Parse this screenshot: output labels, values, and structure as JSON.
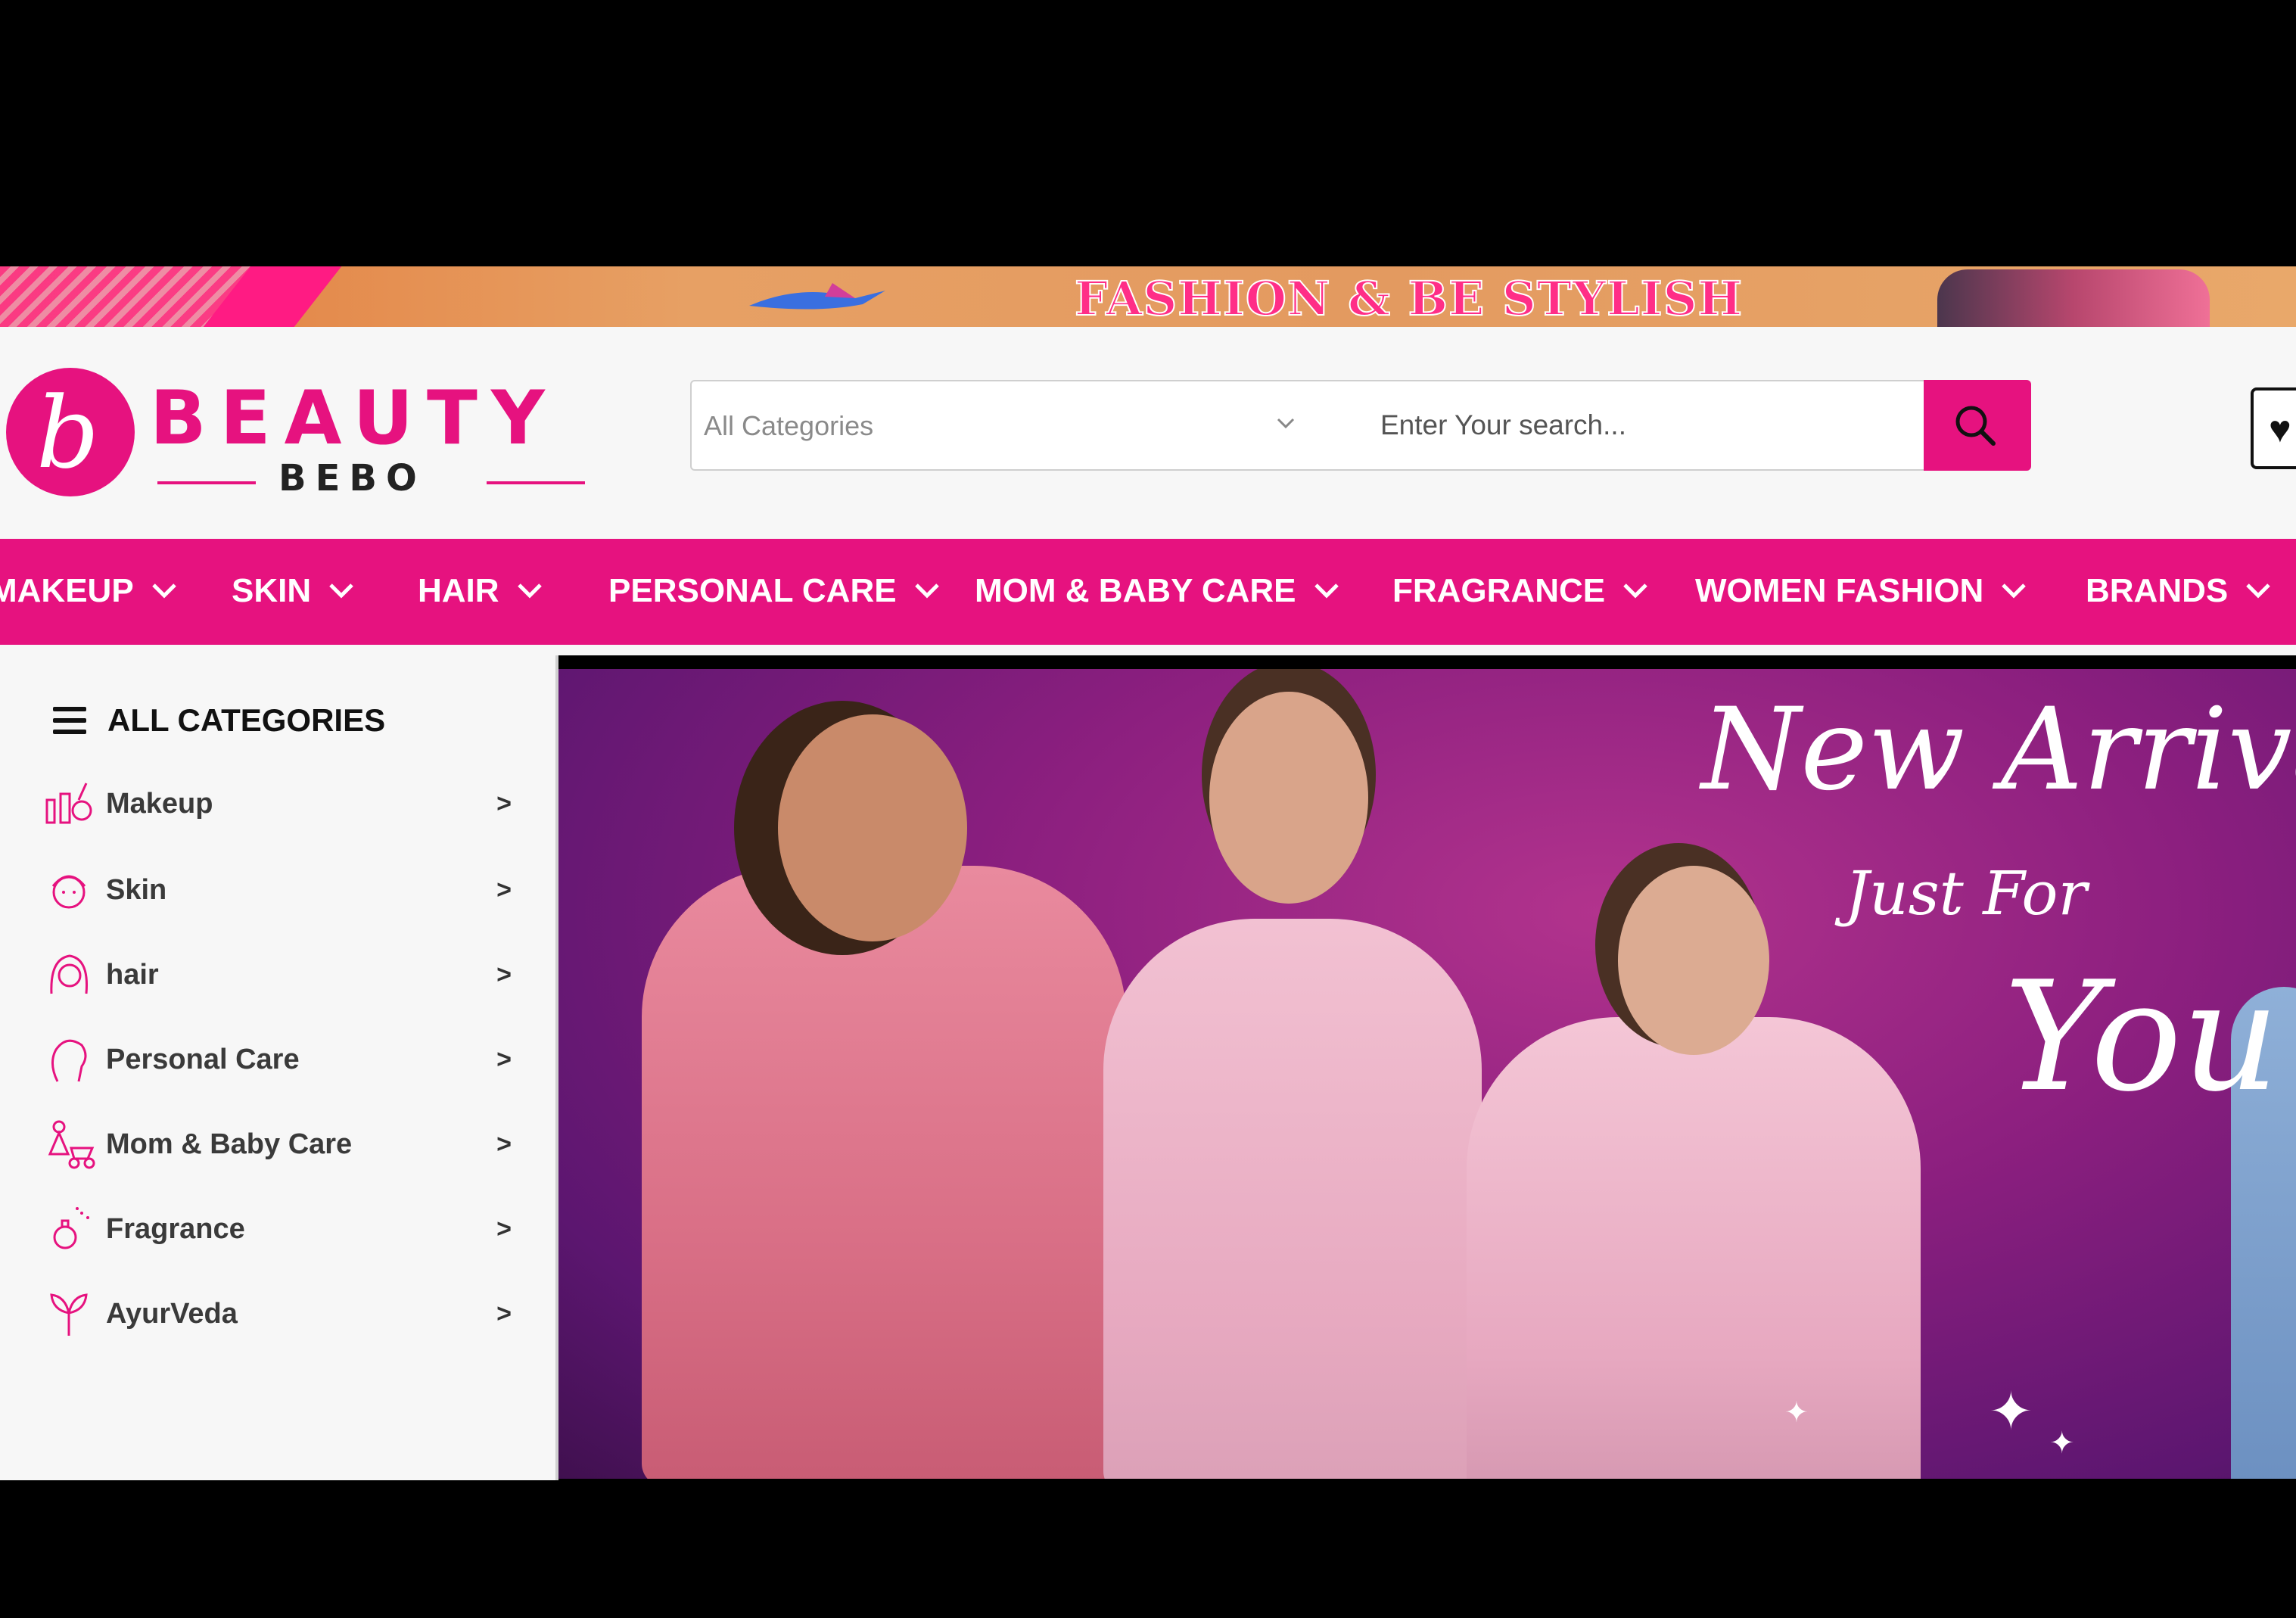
{
  "promo_banner": {
    "text": "FASHION & BE STYLISH"
  },
  "logo": {
    "mark": "b",
    "brand": "BEAUTY",
    "sub": "BEBO"
  },
  "search": {
    "category": "All Categories",
    "placeholder": "Enter Your search..."
  },
  "nav": {
    "items": [
      "MAKEUP",
      "SKIN",
      "HAIR",
      "PERSONAL CARE",
      "MOM & BABY CARE",
      "FRAGRANCE",
      "WOMEN FASHION",
      "BRANDS"
    ]
  },
  "sidebar": {
    "title": "ALL CATEGORIES",
    "items": [
      {
        "label": "Makeup",
        "icon": "makeup-icon",
        "arrow": ">"
      },
      {
        "label": "Skin",
        "icon": "skin-icon",
        "arrow": ">"
      },
      {
        "label": "hair",
        "icon": "hair-icon",
        "arrow": ">"
      },
      {
        "label": "Personal Care",
        "icon": "personal-care-icon",
        "arrow": ">"
      },
      {
        "label": "Mom & Baby Care",
        "icon": "mom-baby-icon",
        "arrow": ">"
      },
      {
        "label": "Fragrance",
        "icon": "fragrance-icon",
        "arrow": ">"
      },
      {
        "label": "AyurVeda",
        "icon": "ayurveda-icon",
        "arrow": ">"
      }
    ]
  },
  "hero": {
    "line1": "New Arrivals",
    "line2": "Just For",
    "line3": "You"
  },
  "colors": {
    "brand": "#e6127f",
    "nav_text": "#ffffff",
    "page_bg": "#f7f7f7"
  }
}
